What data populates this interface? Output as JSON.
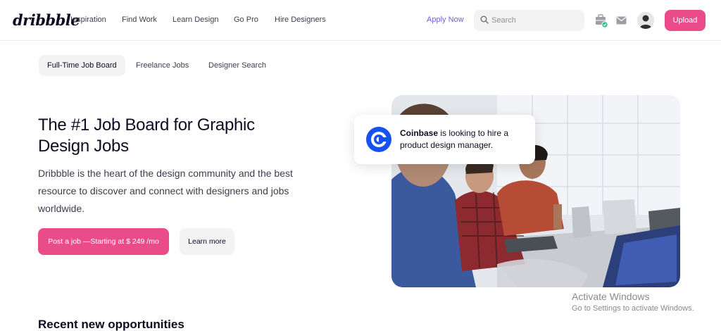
{
  "nav": {
    "logo": "dribbble",
    "links": [
      "Inspiration",
      "Find Work",
      "Learn Design",
      "Go Pro",
      "Hire Designers"
    ],
    "apply": "Apply Now",
    "search_placeholder": "Search",
    "upload": "Upload"
  },
  "tabs": [
    "Full-Time Job Board",
    "Freelance Jobs",
    "Designer Search"
  ],
  "hero": {
    "title": "The #1 Job Board for Graphic Design Jobs",
    "subtitle": "Dribbble is the heart of the design community and the best resource to discover and connect with designers and jobs worldwide.",
    "primary_button": "Post a job —Starting at $ 249 /mo",
    "secondary_button": "Learn more"
  },
  "card": {
    "company": "Coinbase",
    "text": " is looking to hire a product design manager."
  },
  "recent_heading": "Recent new opportunities",
  "windows_notice": {
    "title": "Activate Windows",
    "subtitle": "Go to Settings to activate Windows."
  },
  "colors": {
    "accent": "#ea4c89",
    "apply": "#6b62d6",
    "coinbase": "#1652f0"
  }
}
